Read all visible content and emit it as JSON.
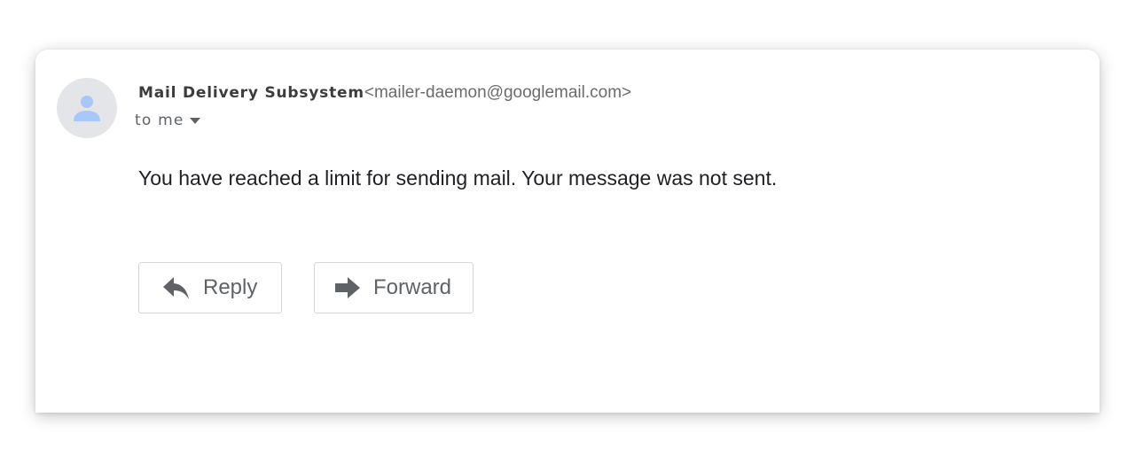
{
  "message": {
    "sender_name": "Mail Delivery Subsystem",
    "sender_email": "<mailer-daemon@googlemail.com>",
    "recipient": "to me",
    "body": "You have reached a limit for sending mail. Your message was not sent."
  },
  "actions": {
    "reply_label": "Reply",
    "forward_label": "Forward"
  },
  "icons": {
    "avatar": "person-icon",
    "recipient_details": "caret-down-icon",
    "reply": "reply-arrow-icon",
    "forward": "forward-arrow-icon"
  },
  "colors": {
    "avatar_background": "#e3e5e8",
    "avatar_figure": "#a8c7fa",
    "icon_gray": "#5f6368",
    "button_border": "#d6d6d6"
  }
}
